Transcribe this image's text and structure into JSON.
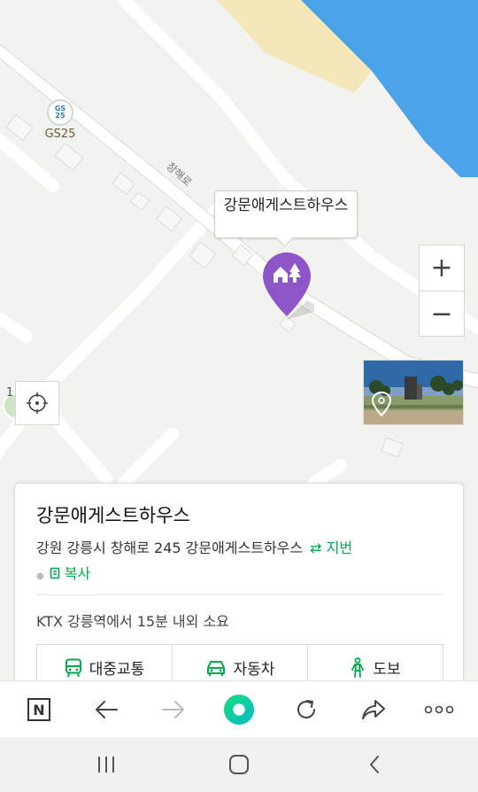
{
  "map": {
    "poi_gs25": {
      "badge_top": "GS",
      "badge_bottom": "25",
      "label": "GS25"
    },
    "road_label": "창해로",
    "place_callout": "강문애게스트하우스",
    "zoom_in_label": "+",
    "zoom_out_label": "−",
    "partial_left_label": "1"
  },
  "place": {
    "name": "강문애게스트하우스",
    "address": "강원 강릉시 창해로 245 강문애게스트하우스",
    "jibeon_label": "⇄ 지번",
    "copy_label": "복사",
    "note": "KTX 강릉역에서 15분 내외 소요",
    "modes": [
      {
        "label": "대중교통",
        "icon": "bus-icon"
      },
      {
        "label": "자동차",
        "icon": "car-icon"
      },
      {
        "label": "도보",
        "icon": "walk-icon"
      }
    ]
  },
  "toolbar": {
    "home_letter": "N",
    "items": [
      "naver-home-icon",
      "back-arrow-icon",
      "forward-arrow-icon",
      "green-dot-icon",
      "refresh-icon",
      "share-icon",
      "more-icon"
    ]
  },
  "colors": {
    "accent_green": "#03a64f",
    "pin_purple": "#8d55c7",
    "water": "#49a3e6",
    "sand": "#f4e7b9"
  }
}
